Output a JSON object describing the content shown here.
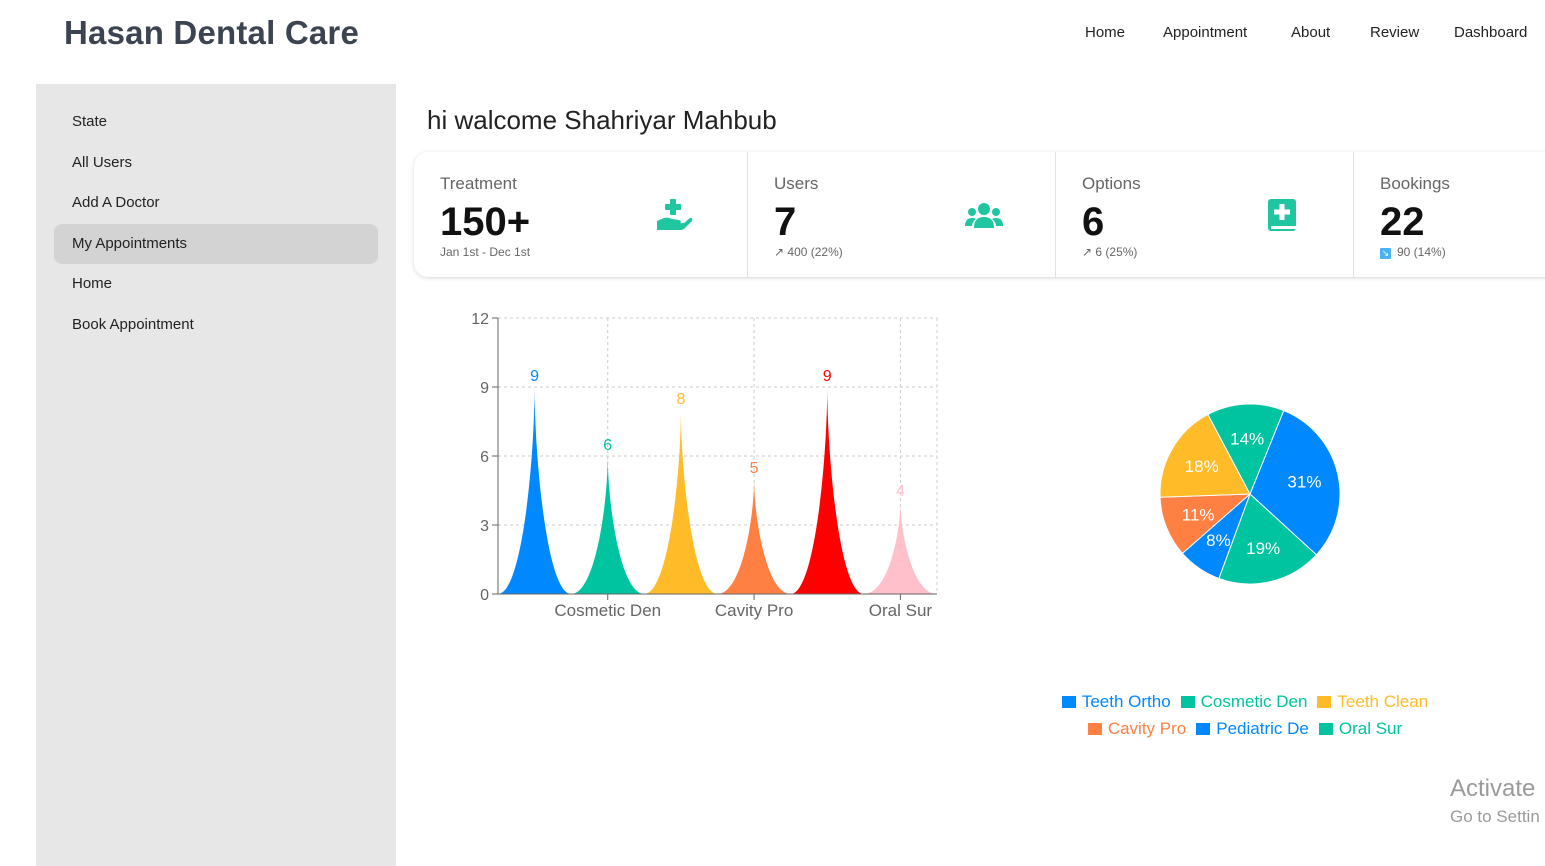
{
  "brand": "Hasan Dental Care",
  "nav": [
    "Home",
    "Appointment",
    "About",
    "Review",
    "Dashboard"
  ],
  "sidebar": {
    "items": [
      "State",
      "All Users",
      "Add A Doctor",
      "My Appointments",
      "Home",
      "Book Appointment"
    ],
    "active": "My Appointments"
  },
  "welcome": "hi walcome Shahriyar Mahbub",
  "stats": [
    {
      "title": "Treatment",
      "value": "150+",
      "desc": "Jan 1st - Dec 1st",
      "icon": "hand-holding-medical-icon"
    },
    {
      "title": "Users",
      "value": "7",
      "desc": "↗ 400 (22%)",
      "icon": "users-icon"
    },
    {
      "title": "Options",
      "value": "6",
      "desc": "↗ 6 (25%)",
      "icon": "medical-book-icon"
    },
    {
      "title": "Bookings",
      "value": "22",
      "desc": "90 (14%)",
      "icon": "trend-down-icon"
    }
  ],
  "colors": {
    "accent": "#1fc6a0",
    "blue": "#0088fe",
    "green": "#00c49f",
    "yellow": "#ffbb28",
    "orange": "#ff8042",
    "red": "#ff0000",
    "pink": "#ffc0cb"
  },
  "chart_data": [
    {
      "type": "bar",
      "categories": [
        "Teeth Ortho",
        "Cosmetic Den",
        "Teeth Clean",
        "Cavity Pro",
        "Pediatric De",
        "Oral Sur"
      ],
      "x_tick_labels": [
        "Cosmetic Den",
        "Cavity Pro",
        "Oral Sur"
      ],
      "values": [
        9,
        6,
        8,
        5,
        9,
        4
      ],
      "colors": [
        "#0088fe",
        "#00c49f",
        "#ffbb28",
        "#ff8042",
        "#ff0000",
        "#ffc0cb"
      ],
      "ylim": [
        0,
        12
      ],
      "yticks": [
        0,
        3,
        6,
        9,
        12
      ],
      "grid": true,
      "shape": "triangle-curve"
    },
    {
      "type": "pie",
      "labels": [
        "Teeth Ortho",
        "Cosmetic Den",
        "Pediatric De",
        "Cavity Pro",
        "Teeth Clean",
        "Oral Sur"
      ],
      "values": [
        31,
        19,
        8,
        11,
        18,
        14
      ],
      "value_labels": [
        "31%",
        "19%",
        "8%",
        "11%",
        "18%",
        "14%"
      ],
      "colors": [
        "#0088fe",
        "#00c49f",
        "#0088fe",
        "#ff8042",
        "#ffbb28",
        "#00c49f"
      ],
      "legend": [
        {
          "name": "Teeth Ortho",
          "color": "#0088fe"
        },
        {
          "name": "Cosmetic Den",
          "color": "#00c49f"
        },
        {
          "name": "Teeth Clean",
          "color": "#ffbb28"
        },
        {
          "name": "Cavity Pro",
          "color": "#ff8042"
        },
        {
          "name": "Pediatric De",
          "color": "#0088fe"
        },
        {
          "name": "Oral Sur",
          "color": "#00c49f"
        }
      ],
      "legend_position": "bottom"
    }
  ],
  "watermark": {
    "line1": "Activate",
    "line2": "Go to Settin"
  }
}
